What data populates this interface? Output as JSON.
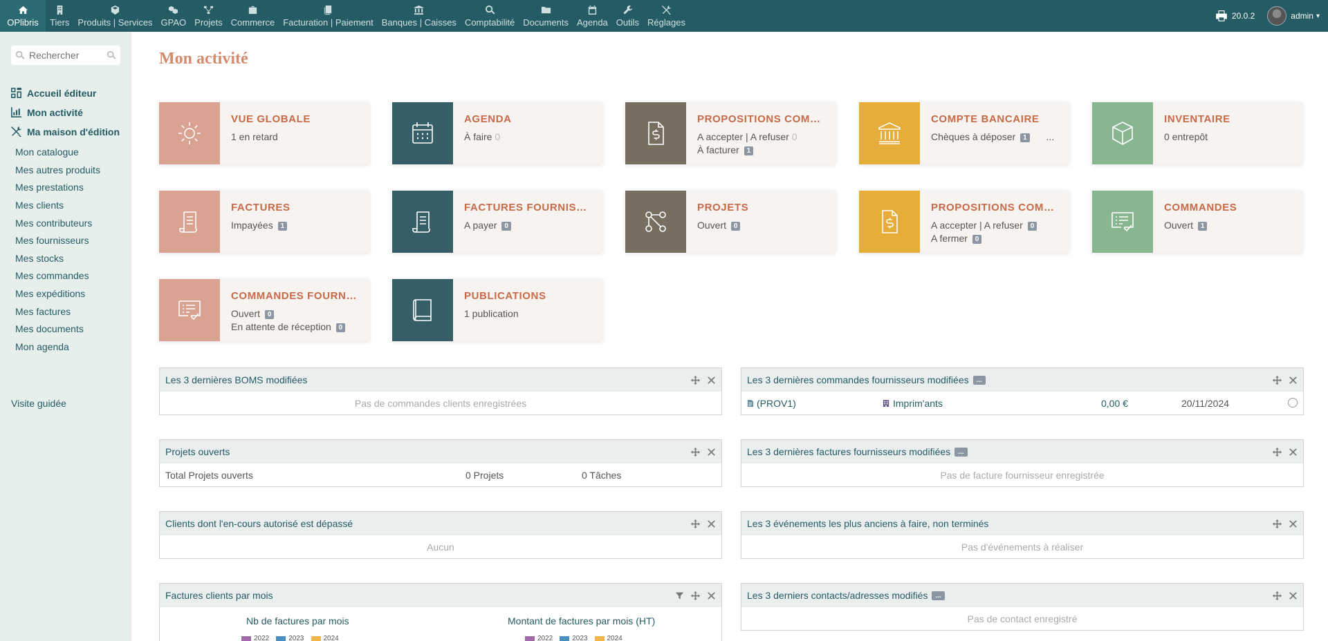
{
  "topbar": {
    "items": [
      {
        "label": "OPlibris",
        "icon": "home-icon"
      },
      {
        "label": "Tiers",
        "icon": "building-icon"
      },
      {
        "label": "Produits | Services",
        "icon": "cube-icon"
      },
      {
        "label": "GPAO",
        "icon": "cubes-icon"
      },
      {
        "label": "Projets",
        "icon": "sitemap-icon"
      },
      {
        "label": "Commerce",
        "icon": "briefcase-icon"
      },
      {
        "label": "Facturation | Paiement",
        "icon": "invoice-icon"
      },
      {
        "label": "Banques | Caisses",
        "icon": "bank-icon"
      },
      {
        "label": "Comptabilité",
        "icon": "search-dollar-icon"
      },
      {
        "label": "Documents",
        "icon": "folder-icon"
      },
      {
        "label": "Agenda",
        "icon": "calendar-icon"
      },
      {
        "label": "Outils",
        "icon": "wrench-icon"
      },
      {
        "label": "Réglages",
        "icon": "tools-icon"
      }
    ],
    "version": "20.0.2",
    "user": "admin"
  },
  "sidebar": {
    "search_placeholder": "Rechercher",
    "main_items": [
      {
        "label": "Accueil éditeur",
        "icon": "dashboard-icon"
      },
      {
        "label": "Mon activité",
        "icon": "chart-icon"
      },
      {
        "label": "Ma maison d'édition",
        "icon": "tools-icon"
      }
    ],
    "sub_items": [
      "Mon catalogue",
      "Mes autres produits",
      "Mes prestations",
      "Mes clients",
      "Mes contributeurs",
      "Mes fournisseurs",
      "Mes stocks",
      "Mes commandes",
      "Mes expéditions",
      "Mes factures",
      "Mes documents",
      "Mon agenda"
    ],
    "visite": "Visite guidée"
  },
  "page": {
    "title": "Mon activité"
  },
  "cards": [
    {
      "title": "VUE GLOBALE",
      "color": "#d9a291",
      "icon": "sun-icon",
      "lines": [
        {
          "text": "1 en retard"
        }
      ]
    },
    {
      "title": "AGENDA",
      "color": "#365e67",
      "icon": "calendar-icon",
      "lines": [
        {
          "text": "À faire",
          "zero": "0"
        }
      ]
    },
    {
      "title": "PROPOSITIONS COMMERCIALES",
      "color": "#786e60",
      "icon": "file-dollar-icon",
      "lines": [
        {
          "text": "A accepter | A refuser",
          "zero": "0"
        },
        {
          "text": "À facturer",
          "badge": "1"
        }
      ]
    },
    {
      "title": "COMPTE BANCAIRE",
      "color": "#e7ad3a",
      "icon": "bank-icon",
      "lines": [
        {
          "text": "Chèques à déposer",
          "badge": "1",
          "extra": "..."
        }
      ]
    },
    {
      "title": "INVENTAIRE",
      "color": "#88b690",
      "icon": "box-icon",
      "lines": [
        {
          "text": "0 entrepôt"
        }
      ]
    },
    {
      "title": "FACTURES",
      "color": "#d9a291",
      "icon": "invoice-icon",
      "lines": [
        {
          "text": "Impayées",
          "badge": "1"
        }
      ]
    },
    {
      "title": "FACTURES FOURNISSEUR",
      "color": "#365e67",
      "icon": "invoice-icon",
      "lines": [
        {
          "text": "A payer",
          "badge": "0"
        }
      ]
    },
    {
      "title": "PROJETS",
      "color": "#786e60",
      "icon": "project-icon",
      "lines": [
        {
          "text": "Ouvert",
          "badge": "0"
        }
      ]
    },
    {
      "title": "PROPOSITIONS COMMERCIALES",
      "color": "#e7ad3a",
      "icon": "file-dollar-icon",
      "lines": [
        {
          "text": "A accepter | A refuser",
          "badge": "0"
        },
        {
          "text": "A fermer",
          "badge": "0"
        }
      ]
    },
    {
      "title": "COMMANDES",
      "color": "#88b690",
      "icon": "order-check-icon",
      "lines": [
        {
          "text": "Ouvert",
          "badge": "1"
        }
      ]
    },
    {
      "title": "COMMANDES FOURNISSEUR",
      "color": "#d9a291",
      "icon": "order-check-icon",
      "lines": [
        {
          "text": "Ouvert",
          "badge": "0"
        },
        {
          "text": "En attente de réception",
          "badge": "0"
        }
      ]
    },
    {
      "title": "PUBLICATIONS",
      "color": "#365e67",
      "icon": "book-icon",
      "lines": [
        {
          "text": "1 publication"
        }
      ]
    }
  ],
  "widgets": {
    "boms": {
      "title": "Les 3 dernières BOMS modifiées",
      "empty": "Pas de commandes clients enregistrées"
    },
    "supplier_orders": {
      "title": "Les 3 dernières commandes fournisseurs modifiées",
      "dots": "...",
      "row": {
        "ref": "(PROV1)",
        "supplier": "Imprim'ants",
        "amount": "0,00 €",
        "date": "20/11/2024"
      }
    },
    "projects": {
      "title": "Projets ouverts",
      "row": {
        "label": "Total Projets ouverts",
        "projects": "0 Projets",
        "tasks": "0 Tâches"
      }
    },
    "supplier_invoices": {
      "title": "Les 3 dernières factures fournisseurs modifiées",
      "dots": "...",
      "empty": "Pas de facture fournisseur enregistrée"
    },
    "clients_over": {
      "title": "Clients dont l'en-cours autorisé est dépassé",
      "empty": "Aucun"
    },
    "events": {
      "title": "Les 3 événements les plus anciens à faire, non terminés",
      "empty": "Pas d'événements à réaliser"
    },
    "invoices_month": {
      "title": "Factures clients par mois",
      "chart1": "Nb de factures par mois",
      "chart2": "Montant de factures par mois (HT)",
      "legend": [
        "2022",
        "2023",
        "2024"
      ]
    },
    "contacts": {
      "title": "Les 3 derniers contacts/adresses modifiés",
      "dots": "...",
      "empty": "Pas de contact enregistré"
    }
  }
}
